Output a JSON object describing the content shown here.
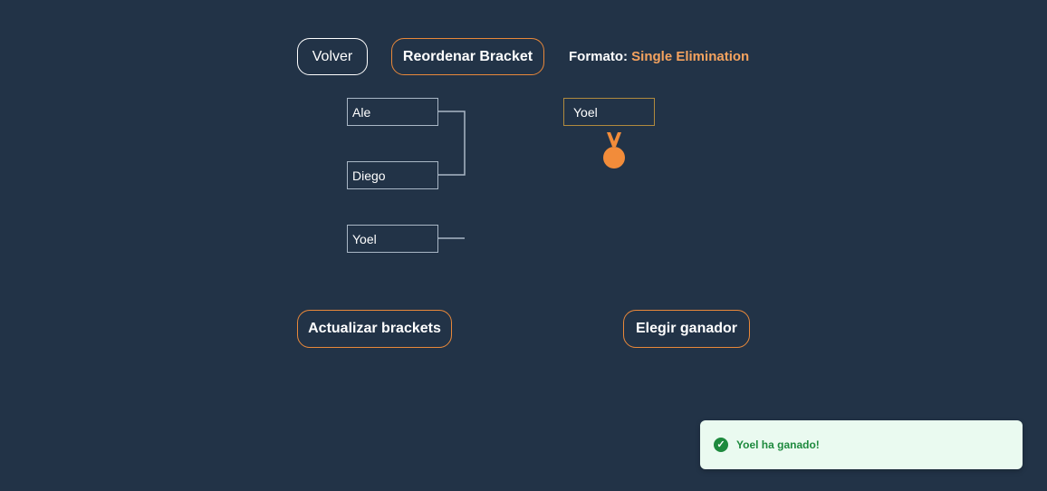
{
  "header": {
    "back_label": "Volver",
    "reorder_label": "Reordenar Bracket",
    "format_label": "Formato:",
    "format_value": "Single Elimination"
  },
  "bracket": {
    "round1": [
      {
        "name": "Ale"
      },
      {
        "name": "Diego"
      },
      {
        "name": "Yoel"
      }
    ],
    "champion": "Yoel",
    "medal_icon": "medal-icon",
    "accent_color": "#f28c3a"
  },
  "actions": {
    "update_label": "Actualizar brackets",
    "choose_winner_label": "Elegir ganador"
  },
  "toast": {
    "icon": "check-circle-icon",
    "message": "Yoel ha ganado!",
    "color": "#1e8a3e"
  },
  "colors": {
    "background": "#223347",
    "button_border_accent": "#e8883a",
    "format_value": "#f5a35f"
  }
}
